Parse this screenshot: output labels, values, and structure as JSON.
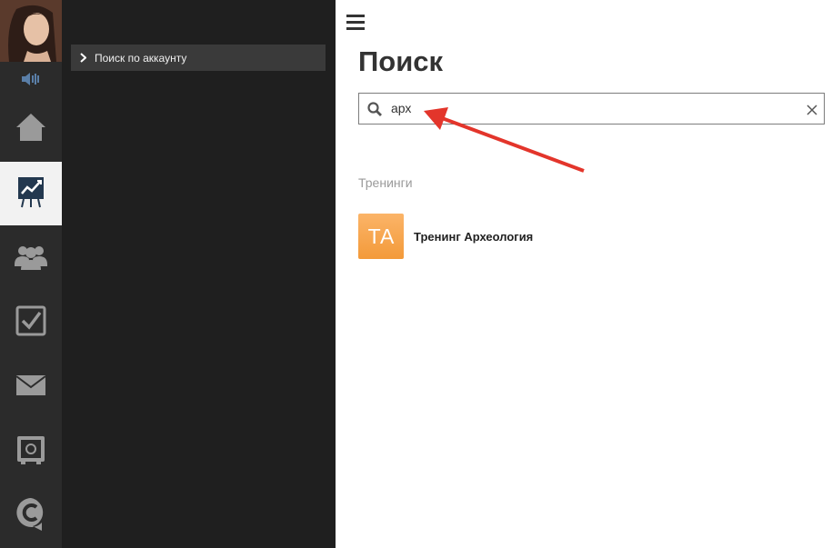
{
  "sidebar": {
    "user_avatar": "user-avatar",
    "items": [
      {
        "name": "home",
        "icon": "home-icon"
      },
      {
        "name": "trainings",
        "icon": "presentation-chart-icon",
        "active": true
      },
      {
        "name": "users",
        "icon": "users-group-icon"
      },
      {
        "name": "tasks",
        "icon": "checkbox-icon"
      },
      {
        "name": "messages",
        "icon": "mail-icon"
      },
      {
        "name": "storage",
        "icon": "safe-icon"
      },
      {
        "name": "brand",
        "icon": "c-logo-icon"
      }
    ]
  },
  "submenu": {
    "items": [
      {
        "label": "Поиск по аккаунту",
        "icon": "chevron-right-icon"
      }
    ]
  },
  "main": {
    "title": "Поиск",
    "search": {
      "value": "арх",
      "placeholder": ""
    },
    "section_label": "Тренинги",
    "results": [
      {
        "initials": "ТА",
        "title": "Тренинг Археология"
      }
    ]
  },
  "colors": {
    "rail_bg": "#2b2b2b",
    "submenu_bg": "#1f1f1f",
    "active_item_bg": "#f2f2f2",
    "badge_orange": "#f7a54a",
    "annotation_arrow": "#e3352b"
  }
}
